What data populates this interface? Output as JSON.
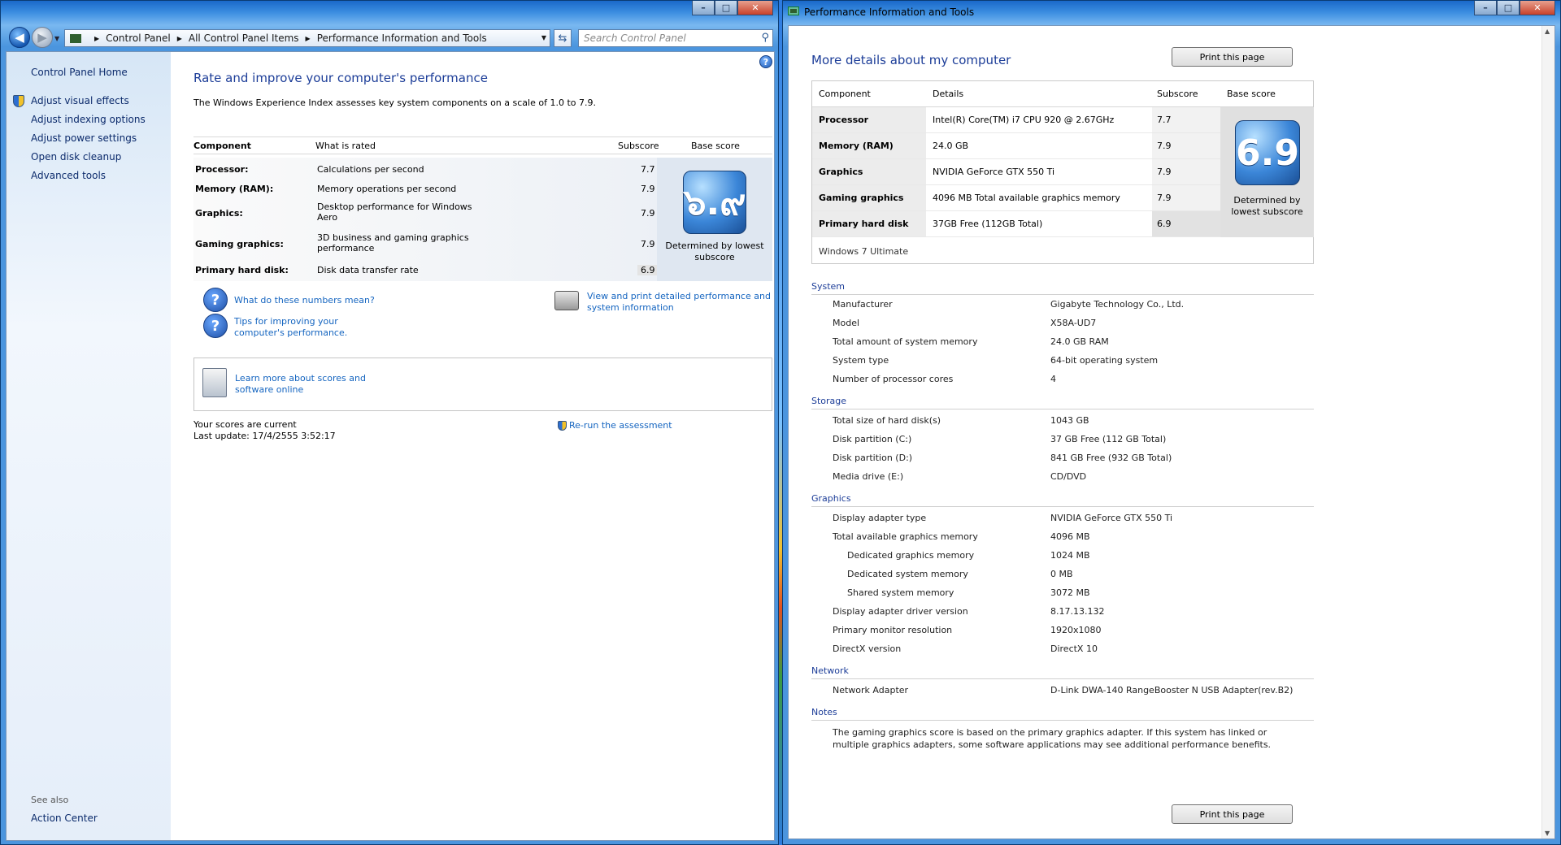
{
  "left_window": {
    "caption": {
      "minimize": "–",
      "maximize": "□",
      "close": "✕"
    },
    "address": {
      "crumbs": [
        "Control Panel",
        "All Control Panel Items",
        "Performance Information and Tools"
      ],
      "search_placeholder": "Search Control Panel"
    },
    "sidebar": {
      "home": "Control Panel Home",
      "links": [
        "Adjust visual effects",
        "Adjust indexing options",
        "Adjust power settings",
        "Open disk cleanup",
        "Advanced tools"
      ],
      "see_also_label": "See also",
      "see_also_links": [
        "Action Center"
      ]
    },
    "main": {
      "title": "Rate and improve your computer's performance",
      "description": "The Windows Experience Index assesses key system components on a scale of 1.0 to 7.9.",
      "table_headers": {
        "component": "Component",
        "what": "What is rated",
        "subscore": "Subscore",
        "base": "Base score"
      },
      "rows": [
        {
          "component": "Processor:",
          "what": "Calculations per second",
          "subscore": "7.7"
        },
        {
          "component": "Memory (RAM):",
          "what": "Memory operations per second",
          "subscore": "7.9"
        },
        {
          "component": "Graphics:",
          "what": "Desktop performance for Windows Aero",
          "subscore": "7.9"
        },
        {
          "component": "Gaming graphics:",
          "what": "3D business and gaming graphics performance",
          "subscore": "7.9"
        },
        {
          "component": "Primary hard disk:",
          "what": "Disk data transfer rate",
          "subscore": "6.9"
        }
      ],
      "base_score": "๖.๙",
      "base_caption": "Determined by lowest subscore",
      "links": {
        "numbers": "What do these numbers mean?",
        "tips": "Tips for improving your computer's performance.",
        "print_details": "View and print detailed performance and system information",
        "learn_more": "Learn more about scores and software online"
      },
      "status": "Your scores are current",
      "last_update": "Last update: 17/4/2555 3:52:17",
      "rerun": "Re-run the assessment"
    }
  },
  "right_window": {
    "title": "Performance Information and Tools",
    "caption": {
      "minimize": "–",
      "maximize": "□",
      "close": "✕"
    },
    "heading": "More details about my computer",
    "print_button": "Print this page",
    "table_headers": {
      "component": "Component",
      "details": "Details",
      "subscore": "Subscore",
      "base": "Base score"
    },
    "rows": [
      {
        "component": "Processor",
        "details": "Intel(R) Core(TM) i7 CPU 920 @ 2.67GHz",
        "subscore": "7.7"
      },
      {
        "component": "Memory (RAM)",
        "details": "24.0 GB",
        "subscore": "7.9"
      },
      {
        "component": "Graphics",
        "details": "NVIDIA GeForce GTX 550 Ti",
        "subscore": "7.9"
      },
      {
        "component": "Gaming graphics",
        "details": "4096 MB Total available graphics memory",
        "subscore": "7.9"
      },
      {
        "component": "Primary hard disk",
        "details": "37GB Free (112GB Total)",
        "subscore": "6.9"
      }
    ],
    "base_score": "6.9",
    "base_caption": "Determined by lowest subscore",
    "edition": "Windows 7 Ultimate",
    "sections": [
      {
        "title": "System",
        "items": [
          {
            "k": "Manufacturer",
            "v": "Gigabyte Technology Co., Ltd."
          },
          {
            "k": "Model",
            "v": "X58A-UD7"
          },
          {
            "k": "Total amount of system memory",
            "v": "24.0 GB RAM"
          },
          {
            "k": "System type",
            "v": "64-bit operating system"
          },
          {
            "k": "Number of processor cores",
            "v": "4"
          }
        ]
      },
      {
        "title": "Storage",
        "items": [
          {
            "k": "Total size of hard disk(s)",
            "v": "1043 GB"
          },
          {
            "k": "Disk partition (C:)",
            "v": "37 GB Free (112 GB Total)"
          },
          {
            "k": "Disk partition (D:)",
            "v": "841 GB Free (932 GB Total)"
          },
          {
            "k": "Media drive (E:)",
            "v": "CD/DVD"
          }
        ]
      },
      {
        "title": "Graphics",
        "items": [
          {
            "k": "Display adapter type",
            "v": "NVIDIA GeForce GTX 550 Ti"
          },
          {
            "k": "Total available graphics memory",
            "v": "4096 MB"
          },
          {
            "k": "Dedicated graphics memory",
            "v": "1024 MB",
            "indent": true
          },
          {
            "k": "Dedicated system memory",
            "v": "0 MB",
            "indent": true
          },
          {
            "k": "Shared system memory",
            "v": "3072 MB",
            "indent": true
          },
          {
            "k": "Display adapter driver version",
            "v": "8.17.13.132"
          },
          {
            "k": "Primary monitor resolution",
            "v": "1920x1080"
          },
          {
            "k": "DirectX version",
            "v": "DirectX 10"
          }
        ]
      },
      {
        "title": "Network",
        "items": [
          {
            "k": "Network Adapter",
            "v": "D-Link DWA-140 RangeBooster N USB Adapter(rev.B2)"
          }
        ]
      },
      {
        "title": "Notes",
        "note": "The gaming graphics score is based on the primary graphics adapter. If this system has linked or multiple graphics adapters, some software applications may see additional performance benefits."
      }
    ]
  }
}
